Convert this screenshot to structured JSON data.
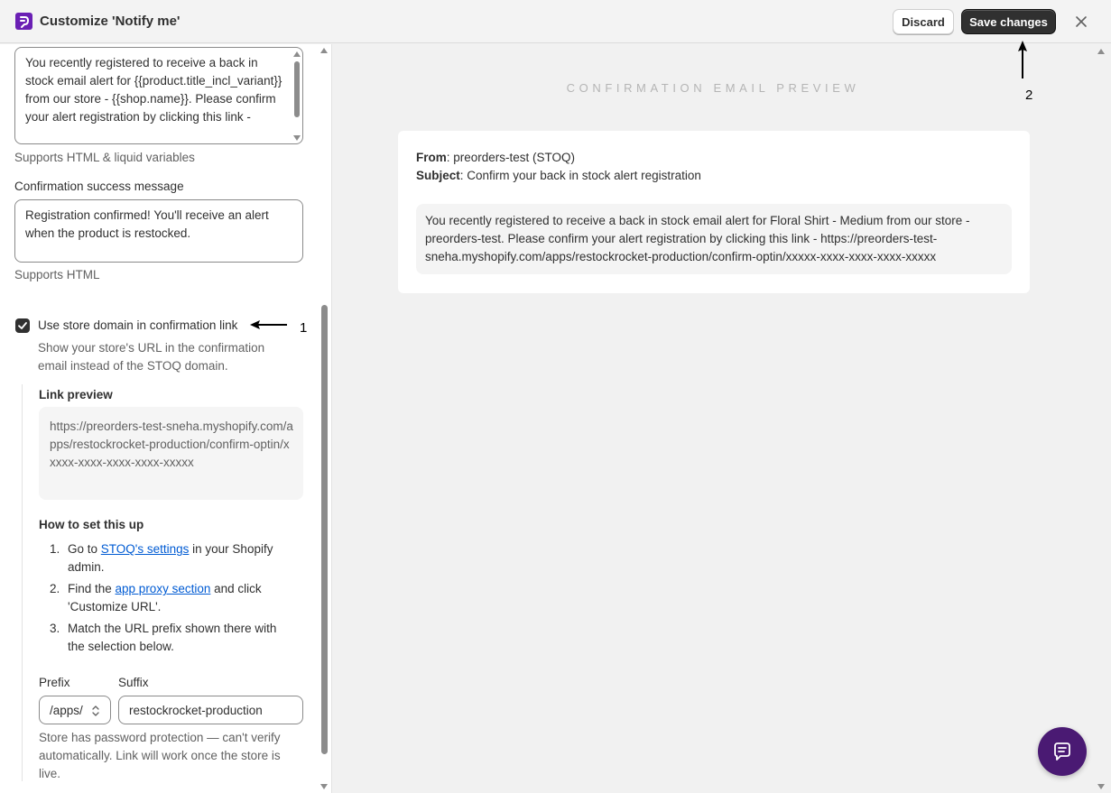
{
  "header": {
    "title": "Customize 'Notify me'",
    "discard_label": "Discard",
    "save_label": "Save changes",
    "logo_icon": "stoq-logo-icon",
    "close_icon": "close-icon"
  },
  "left": {
    "email_body_value": "You recently registered to receive a back in stock email alert for {{product.title_incl_variant}} from our store - {{shop.name}}. Please confirm your alert registration by clicking this link -",
    "email_body_help": "Supports HTML & liquid variables",
    "success_label": "Confirmation success message",
    "success_value": "Registration confirmed! You'll receive an alert when the product is restocked.",
    "success_help": "Supports HTML",
    "use_domain_label": "Use store domain in confirmation link",
    "use_domain_checked": true,
    "use_domain_desc": "Show your store's URL in the confirmation email instead of the STOQ domain.",
    "link_preview_label": "Link preview",
    "link_preview_value": "https://preorders-test-sneha.myshopify.com/apps/restockrocket-production/confirm-optin/xxxxx-xxxx-xxxx-xxxx-xxxxx",
    "setup_heading": "How to set this up",
    "steps": [
      {
        "num": "1.",
        "pre": "Go to ",
        "link": "STOQ's settings",
        "post": " in your Shopify admin."
      },
      {
        "num": "2.",
        "pre": "Find the ",
        "link": "app proxy section",
        "post": " and click 'Customize URL'."
      },
      {
        "num": "3.",
        "pre": "Match the URL prefix shown there with the selection below.",
        "link": "",
        "post": ""
      }
    ],
    "prefix_label": "Prefix",
    "prefix_value": "/apps/",
    "suffix_label": "Suffix",
    "suffix_value": "restockrocket-production",
    "warning_text": "Store has password protection — can't verify automatically. Link will work once the store is live."
  },
  "preview": {
    "title": "CONFIRMATION EMAIL PREVIEW",
    "from_label": "From",
    "from_value": ": preorders-test (STOQ)",
    "subject_label": "Subject",
    "subject_value": ": Confirm your back in stock alert registration",
    "body": "You recently registered to receive a back in stock email alert for Floral Shirt - Medium from our store - preorders-test. Please confirm your alert registration by clicking this link - https://preorders-test-sneha.myshopify.com/apps/restockrocket-production/confirm-optin/xxxxx-xxxx-xxxx-xxxx-xxxxx"
  },
  "annotations": {
    "one": "1",
    "two": "2"
  },
  "colors": {
    "accent": "#303030",
    "brand": "#6a1fb4",
    "chat": "#4a1a73",
    "link": "#005bd3"
  }
}
